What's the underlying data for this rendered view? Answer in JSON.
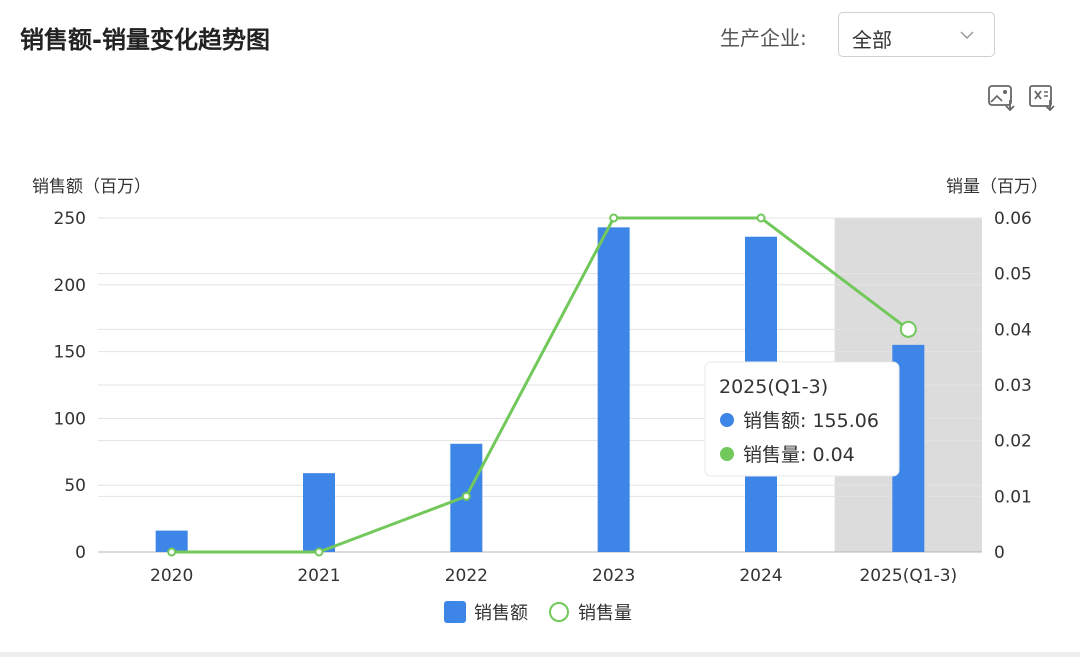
{
  "title": "销售额-销量变化趋势图",
  "filter": {
    "label": "生产企业:",
    "value": "全部"
  },
  "toolbar": {
    "icons": [
      "image-download-icon",
      "excel-download-icon"
    ]
  },
  "colors": {
    "bar": "#3d85e6",
    "line": "#72c85a",
    "highlight": "#dcdcdc",
    "grid": "#e3e3e3"
  },
  "tooltip": {
    "title": "2025(Q1-3)",
    "rows": [
      {
        "label": "销售额: 155.06",
        "color": "#3d85e6"
      },
      {
        "label": "销售量: 0.04",
        "color": "#72c85a"
      }
    ]
  },
  "chart_data": {
    "type": "bar",
    "categories": [
      "2020",
      "2021",
      "2022",
      "2023",
      "2024",
      "2025(Q1-3)"
    ],
    "series": [
      {
        "name": "销售额",
        "type": "bar",
        "axis": "left",
        "values": [
          16,
          59,
          81,
          243,
          236,
          155.06
        ]
      },
      {
        "name": "销售量",
        "type": "line",
        "axis": "right",
        "values": [
          0,
          0,
          0.01,
          0.06,
          0.06,
          0.04
        ]
      }
    ],
    "ylabel_left": "销售额（百万）",
    "ylabel_right": "销量（百万）",
    "ylim_left": [
      0,
      250
    ],
    "ylim_right": [
      0,
      0.06
    ],
    "yticks_left": [
      "0",
      "50",
      "100",
      "150",
      "200",
      "250"
    ],
    "yticks_right": [
      "0",
      "0.01",
      "0.02",
      "0.03",
      "0.04",
      "0.05",
      "0.06"
    ],
    "legend": [
      "销售额",
      "销售量"
    ],
    "legend_position": "bottom-center",
    "highlighted_category": "2025(Q1-3)",
    "grid": true
  }
}
